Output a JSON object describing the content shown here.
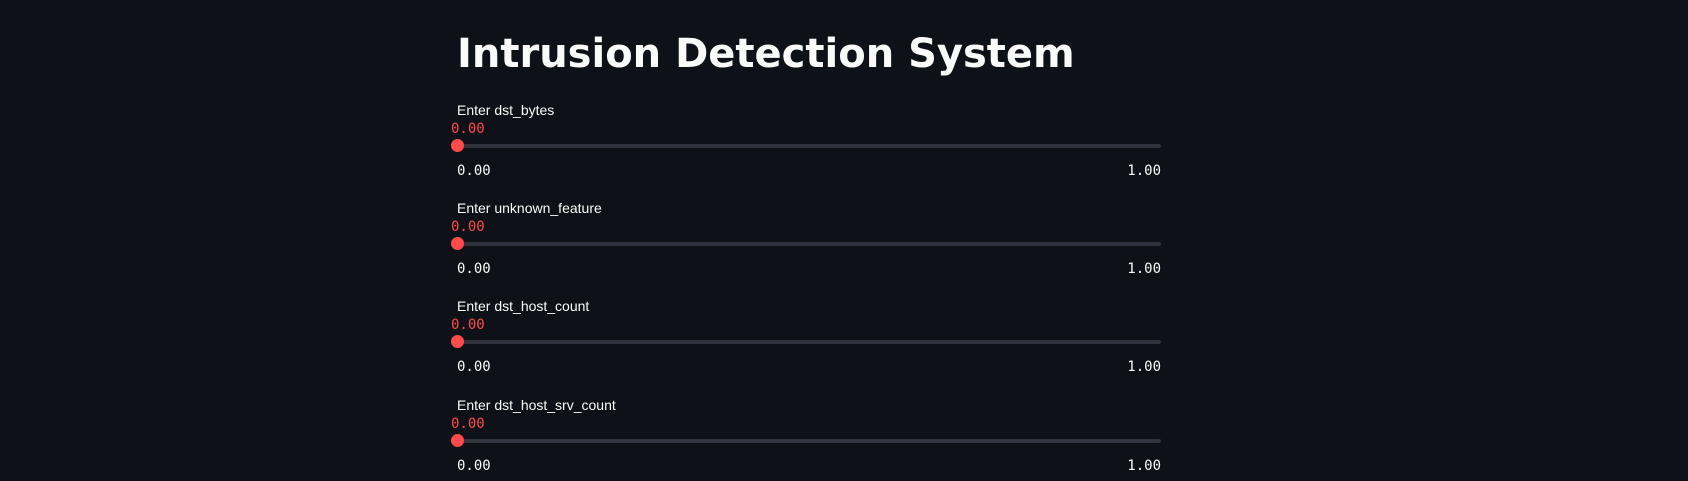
{
  "page": {
    "title": "Intrusion Detection System"
  },
  "theme": {
    "background": "#0e1117",
    "text": "#fafafa",
    "accent": "#ff4b4b",
    "track": "#31333f"
  },
  "sliders": [
    {
      "label": "Enter dst_bytes",
      "value": 0.0,
      "value_text": "0.00",
      "min_text": "0.00",
      "max_text": "1.00",
      "min": 0.0,
      "max": 1.0
    },
    {
      "label": "Enter unknown_feature",
      "value": 0.0,
      "value_text": "0.00",
      "min_text": "0.00",
      "max_text": "1.00",
      "min": 0.0,
      "max": 1.0
    },
    {
      "label": "Enter dst_host_count",
      "value": 0.0,
      "value_text": "0.00",
      "min_text": "0.00",
      "max_text": "1.00",
      "min": 0.0,
      "max": 1.0
    },
    {
      "label": "Enter dst_host_srv_count",
      "value": 0.0,
      "value_text": "0.00",
      "min_text": "0.00",
      "max_text": "1.00",
      "min": 0.0,
      "max": 1.0
    }
  ]
}
